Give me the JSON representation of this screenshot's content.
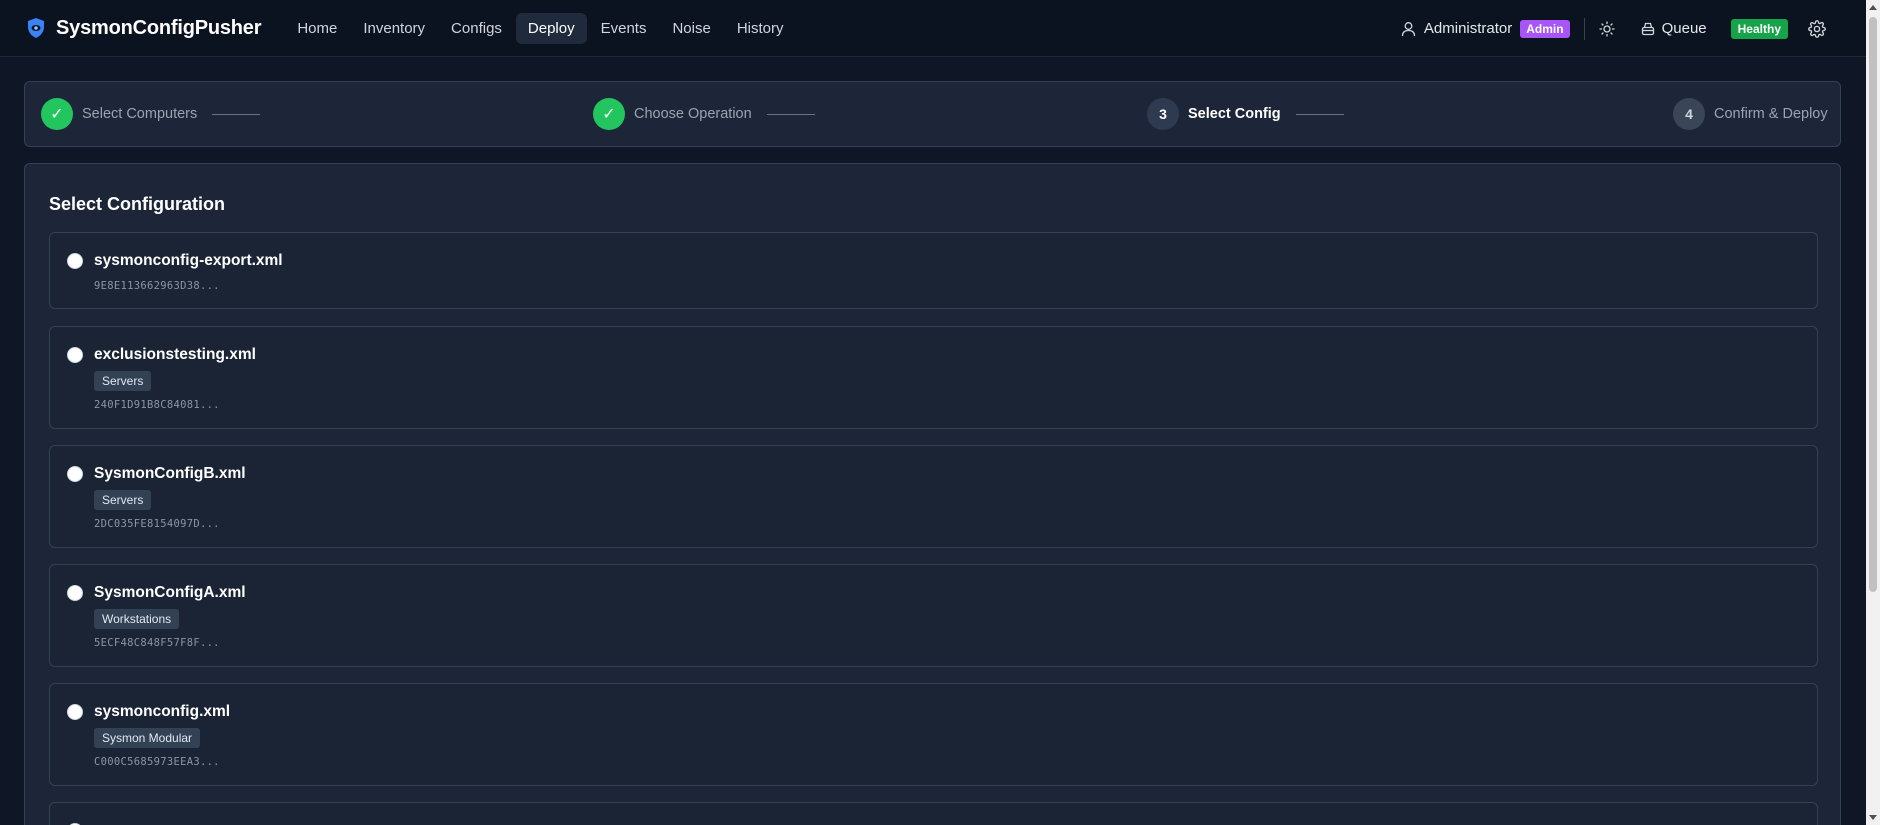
{
  "app": {
    "title": "SysmonConfigPusher"
  },
  "nav": {
    "items": [
      {
        "label": "Home",
        "active": false
      },
      {
        "label": "Inventory",
        "active": false
      },
      {
        "label": "Configs",
        "active": false
      },
      {
        "label": "Deploy",
        "active": true
      },
      {
        "label": "Events",
        "active": false
      },
      {
        "label": "Noise",
        "active": false
      },
      {
        "label": "History",
        "active": false
      }
    ]
  },
  "header": {
    "user_name": "Administrator",
    "role_badge": "Admin",
    "queue_label": "Queue",
    "health_badge": "Healthy",
    "icons": [
      "shield-icon",
      "user-icon",
      "sun-icon",
      "queue-icon",
      "gear-icon"
    ],
    "colors": {
      "role_badge": "#a855f7",
      "health_badge": "#16a34a"
    }
  },
  "stepper": {
    "steps": [
      {
        "number": "✓",
        "label": "Select Computers",
        "state": "done"
      },
      {
        "number": "✓",
        "label": "Choose Operation",
        "state": "done"
      },
      {
        "number": "3",
        "label": "Select Config",
        "state": "current"
      },
      {
        "number": "4",
        "label": "Confirm & Deploy",
        "state": "pending"
      }
    ],
    "colors": {
      "done": "#22c55e"
    }
  },
  "main": {
    "title": "Select Configuration",
    "configs": [
      {
        "name": "sysmonconfig-export.xml",
        "tag": "",
        "hash": "9E8E113662963D38...",
        "selected": false
      },
      {
        "name": "exclusionstesting.xml",
        "tag": "Servers",
        "hash": "240F1D91B8C84081...",
        "selected": false
      },
      {
        "name": "SysmonConfigB.xml",
        "tag": "Servers",
        "hash": "2DC035FE8154097D...",
        "selected": false
      },
      {
        "name": "SysmonConfigA.xml",
        "tag": "Workstations",
        "hash": "5ECF48C848F57F8F...",
        "selected": false
      },
      {
        "name": "sysmonconfig.xml",
        "tag": "Sysmon Modular",
        "hash": "C000C5685973EEA3...",
        "selected": false
      }
    ]
  }
}
